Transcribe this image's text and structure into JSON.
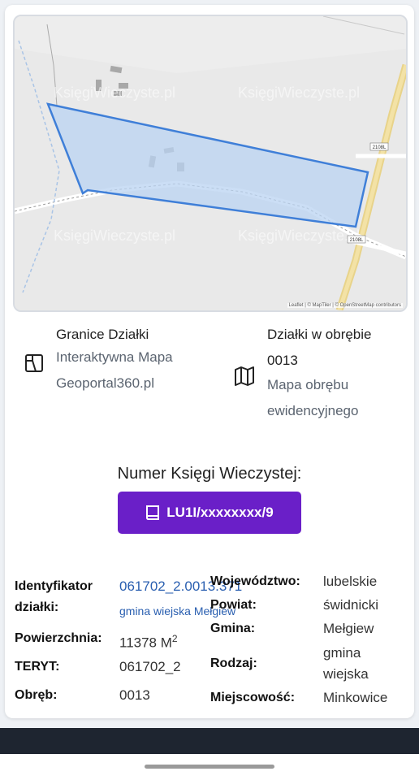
{
  "map": {
    "attribution": "Leaflet | © MapTiler | © OpenStreetMap contributors",
    "watermark": "KsięgiWieczyste.pl",
    "road_labels": [
      "2108L",
      "2108L"
    ],
    "parcel_fill": "#b9d3f2",
    "parcel_stroke": "#3f7fd8"
  },
  "links": {
    "left": {
      "title": "Granice Działki",
      "line1": "Interaktywna Mapa",
      "line2": "Geoportal360.pl",
      "icon": "map-frame-icon"
    },
    "right": {
      "title": "Działki w obrębie",
      "line1": "0013",
      "line2": "Mapa obrębu",
      "line3": "ewidencyjnego",
      "icon": "folded-map-icon"
    }
  },
  "ksiega": {
    "label": "Numer Księgi Wieczystej:",
    "value": "LU1I/xxxxxxxx/9",
    "icon": "book-icon",
    "color": "#6a1fc8"
  },
  "details": {
    "identyfikator_label_1": "Identyfikator",
    "identyfikator_label_2": "działki:",
    "identyfikator_value": "061702_2.0013.371",
    "identyfikator_sub": "gmina wiejska Mełgiew",
    "powierzchnia_label": "Powierzchnia:",
    "powierzchnia_value": "11378 M",
    "powierzchnia_unit_sup": "2",
    "teryt_label": "TERYT:",
    "teryt_value": "061702_2",
    "obreb_label": "Obręb:",
    "obreb_value": "0013",
    "wojewodztwo_label": "Województwo:",
    "wojewodztwo_value": "lubelskie",
    "powiat_label": "Powiat:",
    "powiat_value": "świdnicki",
    "gmina_label": "Gmina:",
    "gmina_value": "Mełgiew",
    "rodzaj_label": "Rodzaj:",
    "rodzaj_value_1": "gmina",
    "rodzaj_value_2": "wiejska",
    "miejscowosc_label": "Miejscowość:",
    "miejscowosc_value": "Minkowice",
    "link_color": "#2a5fb0"
  }
}
